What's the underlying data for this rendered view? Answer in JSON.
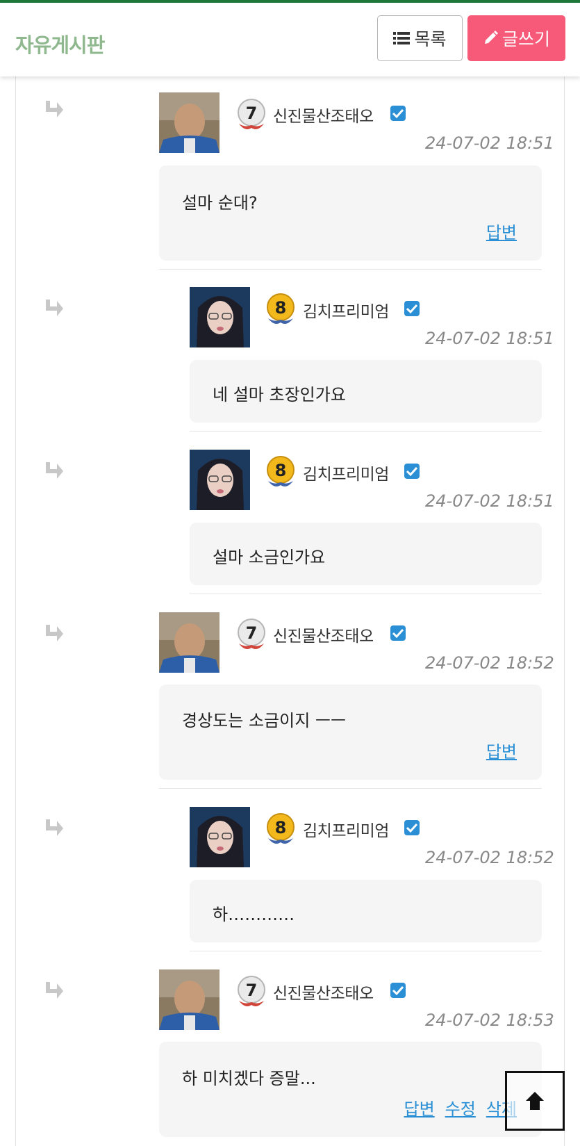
{
  "header": {
    "board_title": "자유게시판",
    "list_label": "목록",
    "write_label": "글쓰기"
  },
  "colors": {
    "accent": "#f65a78",
    "link": "#2a8fd4",
    "title": "#8fb88f"
  },
  "comments": [
    {
      "author": "신진물산조태오",
      "level": "7",
      "datetime": "24-07-02 18:51",
      "text": "설마 순대?",
      "reply": "답변"
    },
    {
      "author": "김치프리미엄",
      "level": "8",
      "datetime": "24-07-02 18:51",
      "text": "네 설마 초장인가요"
    },
    {
      "author": "김치프리미엄",
      "level": "8",
      "datetime": "24-07-02 18:51",
      "text": "설마 소금인가요"
    },
    {
      "author": "신진물산조태오",
      "level": "7",
      "datetime": "24-07-02 18:52",
      "text": "경상도는 소금이지 ㅡㅡ",
      "reply": "답변"
    },
    {
      "author": "김치프리미엄",
      "level": "8",
      "datetime": "24-07-02 18:52",
      "text": "하…………"
    },
    {
      "author": "신진물산조태오",
      "level": "7",
      "datetime": "24-07-02 18:53",
      "text": "하 미치겠다 증말...",
      "reply": "답변",
      "edit": "수정",
      "delete": "삭제"
    }
  ],
  "icons": {
    "reply": "reply-arrow-icon",
    "verified": "check-icon",
    "list": "list-icon",
    "write": "pencil-icon",
    "top": "arrow-up-icon"
  }
}
